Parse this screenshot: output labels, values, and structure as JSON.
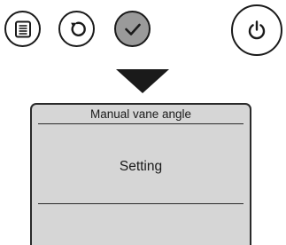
{
  "controls": {
    "buttons": [
      {
        "name": "menu-button",
        "icon": "menu-list-icon"
      },
      {
        "name": "return-button",
        "icon": "return-arrow-icon"
      },
      {
        "name": "select-button",
        "icon": "checkmark-icon",
        "state": "pressed"
      },
      {
        "name": "power-button",
        "icon": "power-icon"
      }
    ],
    "indicator": "down-arrow-icon"
  },
  "screen": {
    "title": "Manual vane angle",
    "message": "Setting"
  },
  "colors": {
    "outline": "#1a1a1a",
    "pressed_button_fill": "#9a9a9a",
    "screen_background": "#d6d6d6"
  }
}
